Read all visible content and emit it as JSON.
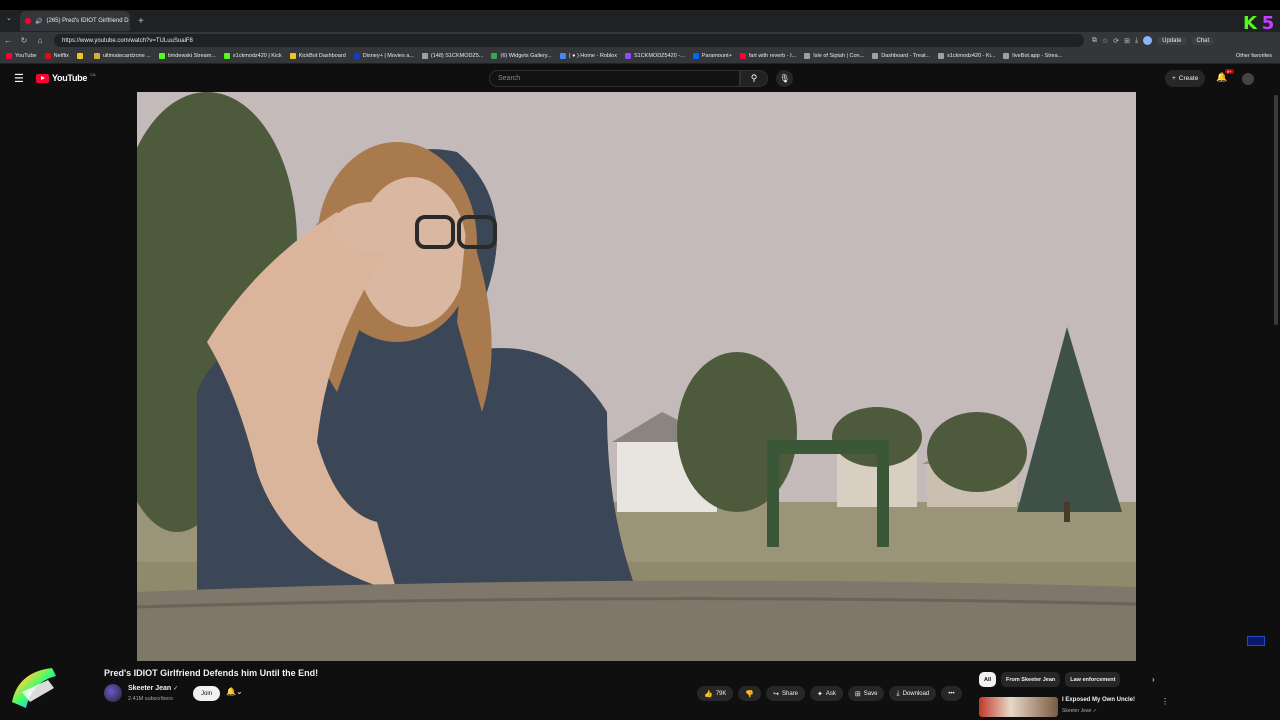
{
  "browser": {
    "tab_title": "(265) Pred's IDIOT Girlfriend D",
    "tab_close": "×",
    "new_tab": "+",
    "url": "https://www.youtube.com/watch?v=TULuuSuaiF8",
    "update_label": "Update",
    "chat_label": "Chat",
    "logo_k": "K",
    "logo_s": "5",
    "bookmarks": [
      {
        "label": "YouTube",
        "color": "#ff0033"
      },
      {
        "label": "Netflix",
        "color": "#e50914"
      },
      {
        "label": "",
        "color": "#f5c518"
      },
      {
        "label": "ultimatecardzone ...",
        "color": "#d4af37"
      },
      {
        "label": "timdewski Stream...",
        "color": "#53fc18"
      },
      {
        "label": "s1ckmodz420 | Kick",
        "color": "#53fc18"
      },
      {
        "label": "KickBot Dashboard",
        "color": "#f5c518"
      },
      {
        "label": "Disney+ | Movies a...",
        "color": "#113ccf"
      },
      {
        "label": "(148) S1CKMODZ5...",
        "color": "#9aa0a6"
      },
      {
        "label": "(6) Widgets Gallery...",
        "color": "#34a853"
      },
      {
        "label": "( ● ) Home - Roblox",
        "color": "#4285f4"
      },
      {
        "label": "S1CKMODZ5420 -...",
        "color": "#9146ff"
      },
      {
        "label": "Paramount+",
        "color": "#0064ff"
      },
      {
        "label": "fart with reverb - I...",
        "color": "#ff0033"
      },
      {
        "label": "Isle of Siptah | Con...",
        "color": "#9aa0a6"
      },
      {
        "label": "Dashboard - Treat...",
        "color": "#9aa0a6"
      },
      {
        "label": "s1ckmodz420 - Ki...",
        "color": "#9aa0a6"
      },
      {
        "label": "liveBot.app - Strea...",
        "color": "#9aa0a6"
      }
    ],
    "other_favorites": "Other favorites"
  },
  "youtube": {
    "logo_text": "YouTube",
    "country_code": "CA",
    "search_placeholder": "Search",
    "create_label": "Create",
    "notif_count": "9+"
  },
  "video": {
    "title": "Pred's IDIOT Girlfriend Defends him Until the End!",
    "channel": "Skeeter Jean",
    "subscribers": "2.41M subscribers",
    "join_label": "Join",
    "likes": "79K",
    "share_label": "Share",
    "ask_label": "Ask",
    "save_label": "Save",
    "download_label": "Download",
    "more_label": "•••"
  },
  "sidebar": {
    "chips": [
      "All",
      "From Skeeter Jean",
      "Law enforcement"
    ],
    "rec_title": "I Exposed My Own Uncle!",
    "rec_channel": "Skeeter Jean ✓"
  },
  "icons": {
    "menu": "☰",
    "search": "⚲",
    "mic": "🎙",
    "bell": "🔔",
    "like": "👍",
    "dislike": "👎",
    "share": "↪",
    "ask": "✦",
    "save": "⊞",
    "download": "⤓",
    "next": "›",
    "kebab": "⋮"
  }
}
